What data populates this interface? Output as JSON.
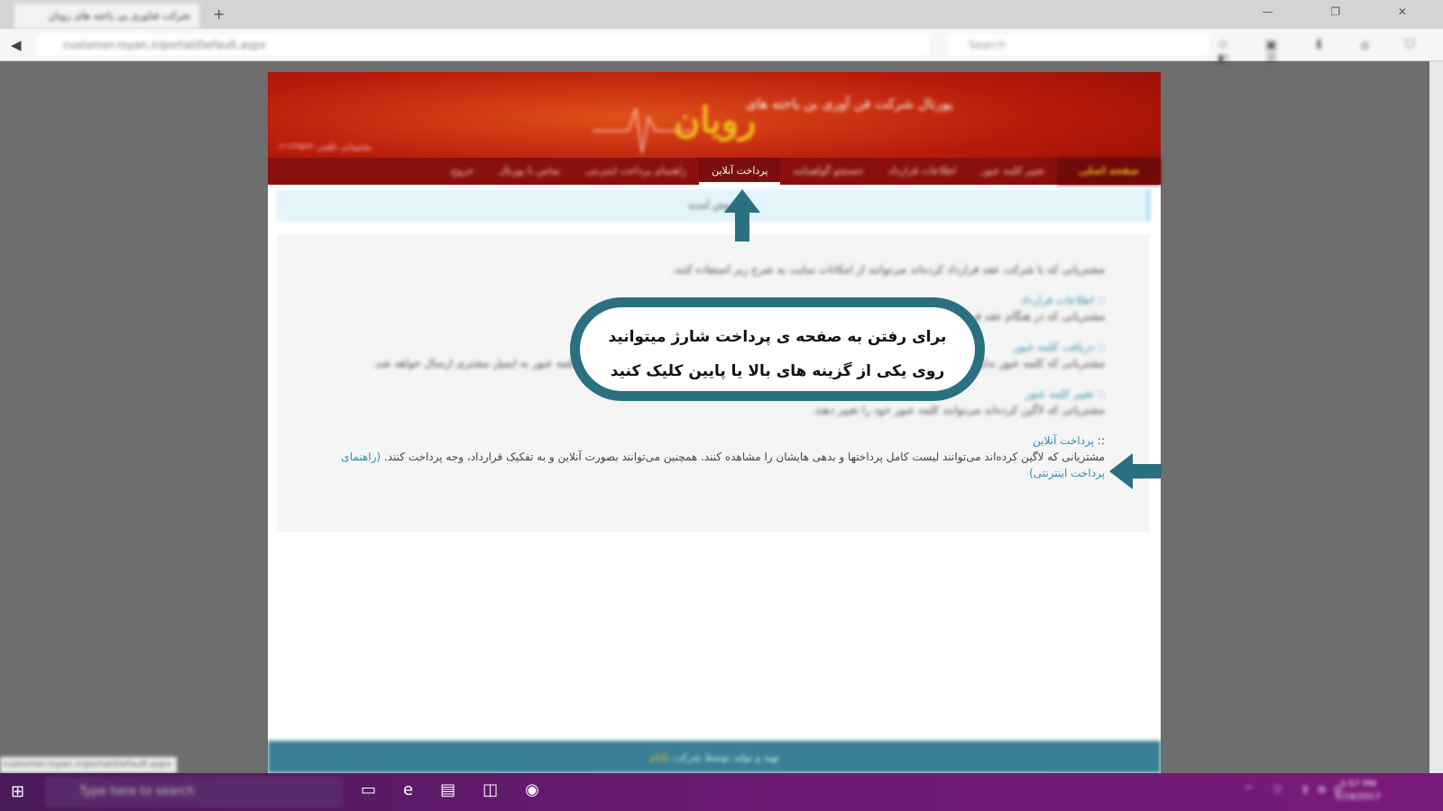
{
  "browser": {
    "tab_title": "شرکت فناوری پی پاخته های رویان",
    "url": "customer.royan.ir/portal/Default.aspx",
    "search_placeholder": "Search",
    "new_tab": "+",
    "window_controls": "— ❐ ✕",
    "toolbar_icons": "☆ ▣ ⬇ ⌂ ⛉ ◧ ☰",
    "status_url": "customer.royan.ir/portal/Default.aspx"
  },
  "header": {
    "logo": "رویان",
    "slogan": "پورتال شرکت فن آوری بن یاخته های",
    "support": "پشتیبانی تلفنی ۰۲۱۲۳۵۶۲"
  },
  "nav": {
    "items": [
      {
        "label": "صفحه اصلی"
      },
      {
        "label": "تغییر کلمه عبور"
      },
      {
        "label": "اطلاعات قرارداد"
      },
      {
        "label": "جستجو گواهینامه"
      },
      {
        "label": "پرداخت آنلاین"
      },
      {
        "label": "راهنمای پرداخت اینترنتی"
      },
      {
        "label": "تماس با پورتال"
      },
      {
        "label": "خروج"
      }
    ]
  },
  "notice": "خوش آمدید",
  "main": {
    "intro": "مشتریانی که با شرکت عقد قرارداد کرده‌اند می‌توانند از امکانات سایت به شرح زیر استفاده کنند.",
    "sections": [
      {
        "title": ":: اطلاعات قرارداد",
        "text": "مشتریانی که در هنگام عقد قرارداد ایمیل خود را ثبت نموده‌اند، می‌توانند اطلاعات قرارداد خود را مشاهده کنند."
      },
      {
        "title": ":: دریافت کلمه عبور",
        "text": "مشتریانی که کلمه عبور ندارند می‌توانند از طریق فرم دریافت کلمه عبور اقدام کنند. در صورت صحت اطلاعات وارده، کلمه عبور به ایمیل مشتری ارسال خواهد شد."
      },
      {
        "title": ":: تغییر کلمه عبور",
        "text": "مشتریانی که لاگین کرده‌اند می‌توانند کلمه عبور خود را تغییر دهند."
      }
    ],
    "payment": {
      "prefix": "::",
      "title": "پرداخت آنلاین",
      "text": "مشتریانی که لاگین کرده‌اند می‌توانند لیست کامل پرداختها و بدهی هایشان را مشاهده کنند. همچنین می‌توانند بصورت آنلاین و به تفکیک قرارداد، وجه پرداخت کنند.",
      "link_open": "(",
      "link": "راهنمای پرداخت اینترنتی",
      "link_close": ")"
    }
  },
  "callout": {
    "line1": "برای رفتن به صفحه ی پرداخت شارژ میتوانید",
    "line2": "روی یکی از گزینه های بالا یا پایین کلیک کنید"
  },
  "footer": {
    "text": "تهیه و تولید توسط شرکت",
    "company": "تکتام"
  },
  "taskbar": {
    "search_placeholder": "Type here to search",
    "tray": "^ ⛉ ENG",
    "time": "3:57 PM",
    "date": "5/16/2017"
  },
  "colors": {
    "accent": "#2a7080",
    "header_red": "#b81a0a",
    "logo_yellow": "#f2c21c",
    "footer": "#3a7f95"
  }
}
